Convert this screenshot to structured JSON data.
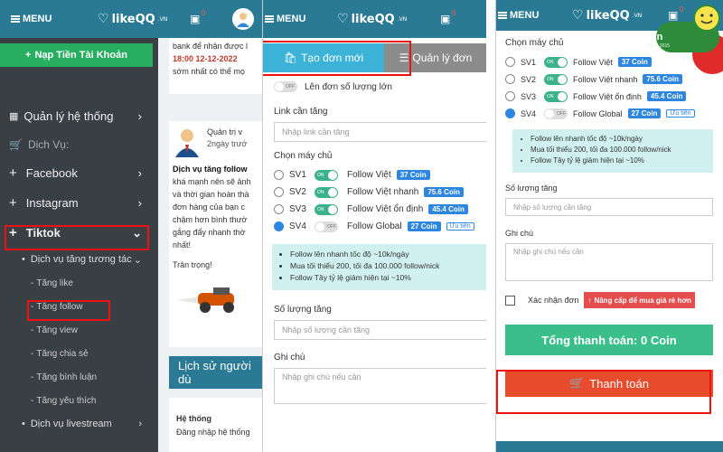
{
  "header": {
    "menu": "MENU",
    "logo": "likeQQ",
    "logo_suffix": ".VN",
    "wallet_count": "0"
  },
  "sidebar": {
    "deposit": "Nạp Tiền Tài Khoản",
    "manage": "Quản lý hệ thống",
    "services_label": "Dịch Vụ:",
    "items": [
      "Facebook",
      "Instagram",
      "Tiktok"
    ],
    "sub_group": "Dịch vụ tăng tương tác",
    "subs": [
      "Tăng like",
      "Tăng follow",
      "Tăng view",
      "Tăng chia sẻ",
      "Tăng bình luận",
      "Tăng yêu thích"
    ],
    "livestream": "Dịch vụ livestream"
  },
  "notice": {
    "top_text": "bank để nhận được l",
    "time_line_prefix": "18:00 ",
    "time_line_date": "12-12-2022",
    "top_text2": "sớm nhất có thể mọ",
    "author": "Quản trị v",
    "ago": "2ngày trướ",
    "title": "Dịch vụ tăng follow",
    "body1": "khá mạnh nên sẽ ảnh",
    "body2": "và thời gian hoàn thà",
    "body3": "đơn hàng của bạn c",
    "body4": "chậm hơn bình thườ",
    "body5": "gắng đẩy nhanh thờ",
    "body6": "nhất!",
    "sign": "Trân trọng!",
    "history": "Lịch sử người dù",
    "system_col": "Hệ thống",
    "system_val": "Đăng nhập hệ thống"
  },
  "form": {
    "tab_create": "Tạo đơn mới",
    "tab_manage": "Quản lý đơn",
    "bulk": "Lên đơn số lượng lớn",
    "bulk_toggle": "OFF",
    "link_label": "Link cần tăng",
    "link_placeholder": "Nhập link cần tăng",
    "server_label": "Chọn máy chủ",
    "servers": [
      {
        "name": "SV1",
        "toggle": "ON",
        "desc": "Follow Việt",
        "price": "37 Coin"
      },
      {
        "name": "SV2",
        "toggle": "ON",
        "desc": "Follow Việt nhanh",
        "price": "75.6 Coin"
      },
      {
        "name": "SV3",
        "toggle": "ON",
        "desc": "Follow Việt ổn định",
        "price": "45.4 Coin"
      },
      {
        "name": "SV4",
        "toggle": "OFF",
        "desc": "Follow Global",
        "price": "27 Coin",
        "tag": "Ưu tiên"
      }
    ],
    "info": [
      "Follow lên nhanh tốc độ ~10k/ngày",
      "Mua tối thiểu 200, tối đa 100.000 follow/nick",
      "Follow Tây tỷ lệ giảm hiện tại ~10%"
    ],
    "qty_label": "Số lượng tăng",
    "qty_placeholder": "Nhập số lượng cần tăng",
    "note_label": "Ghi chú",
    "note_placeholder": "Nhập ghi chú nếu cần",
    "confirm": "Xác nhận đơn",
    "upgrade": "Nâng cấp để mua giá rẻ hơn",
    "total": "Tổng thanh toán: 0  Coin",
    "pay": "Thanh toán"
  },
  "brand_badge": {
    "name": "Likeqq.vn",
    "since": "Since 2015"
  }
}
